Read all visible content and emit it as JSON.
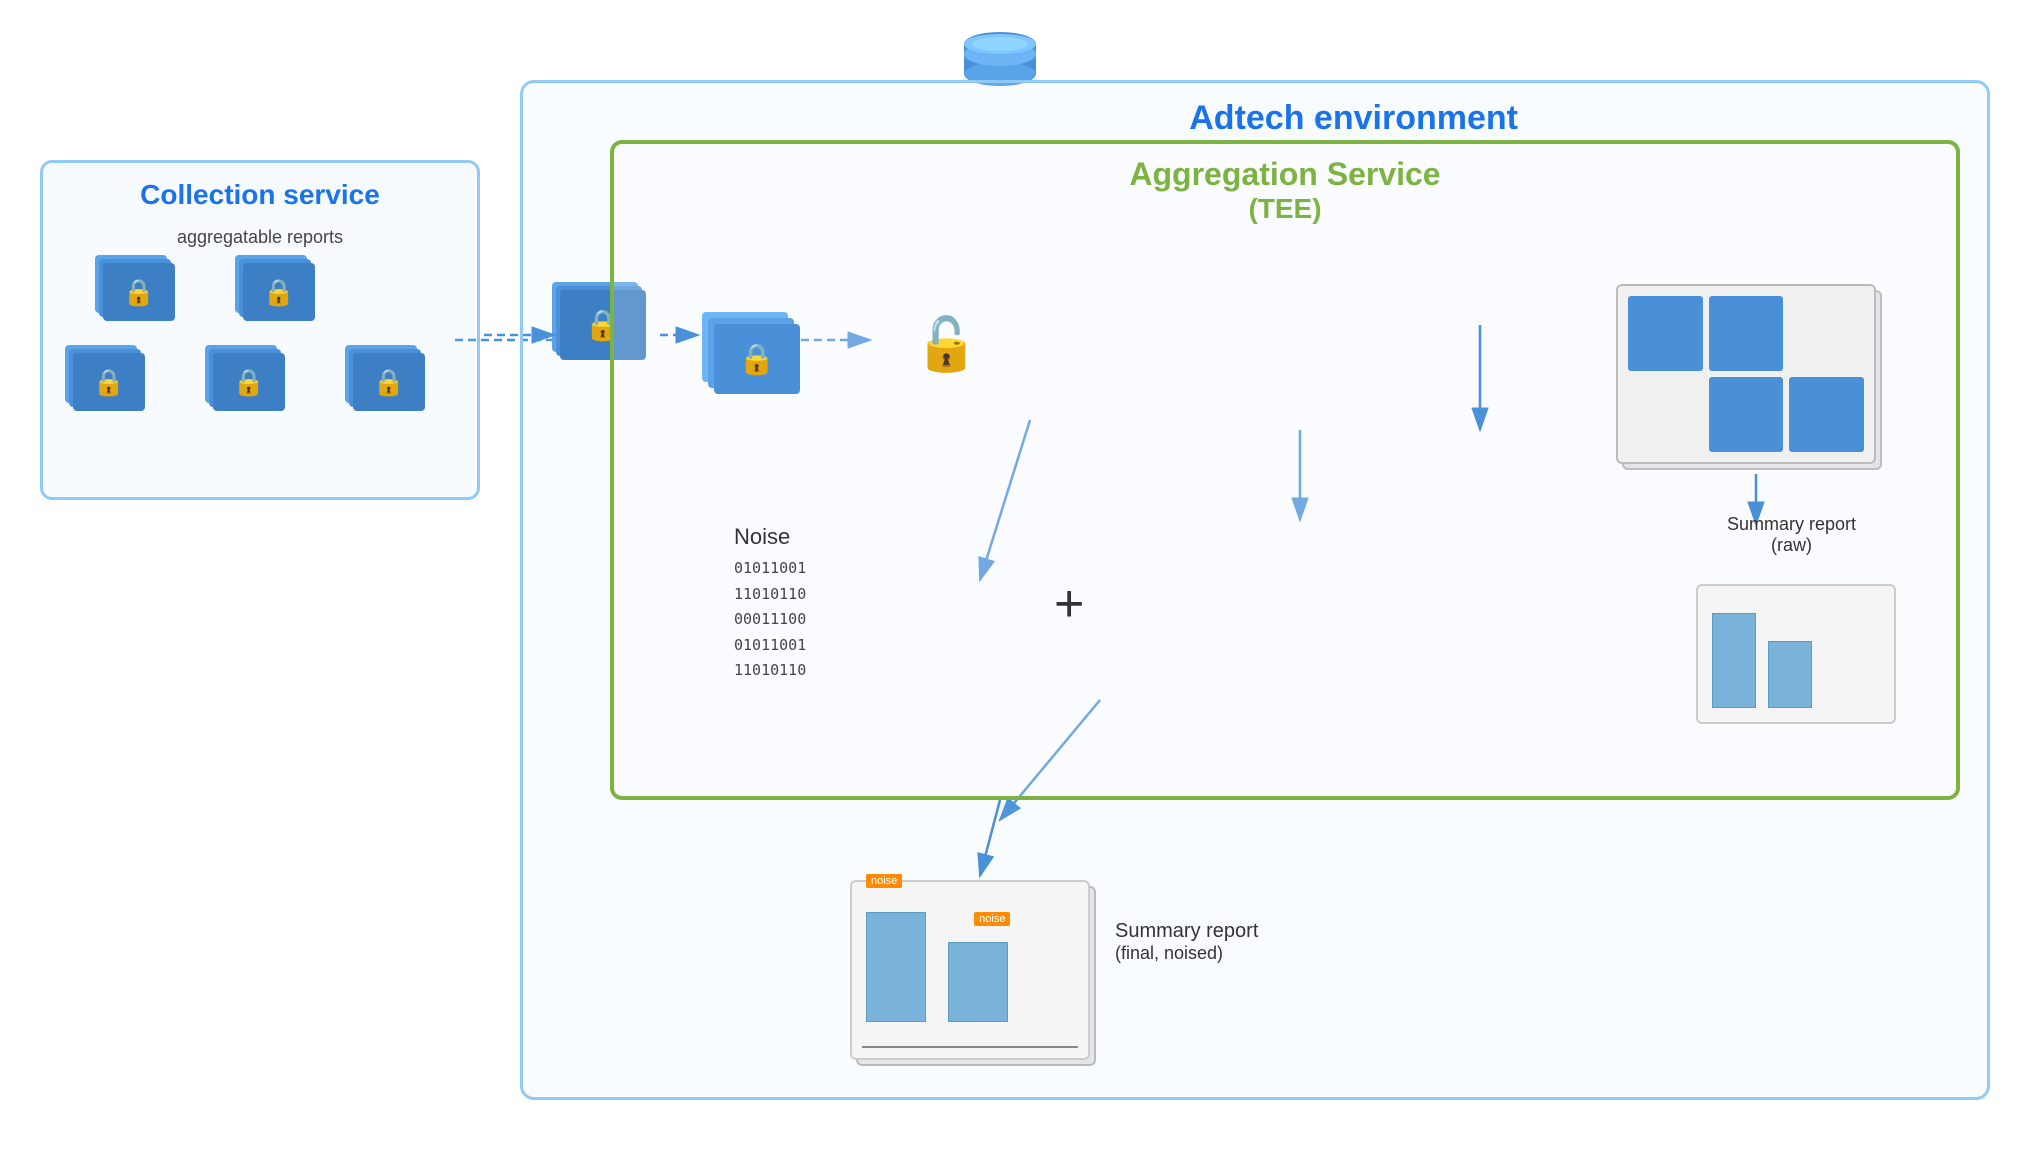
{
  "adtech": {
    "env_label": "Adtech environment",
    "aggregation_service_label": "Aggregation Service",
    "aggregation_service_sub": "(TEE)",
    "collection_service_label": "Collection service",
    "aggregatable_reports": "aggregatable reports",
    "noise_label": "Noise",
    "noise_binary": [
      "01011001",
      "11010110",
      "00011100",
      "01011001",
      "11010110"
    ],
    "summary_report_raw_label": "Summary report",
    "summary_report_raw_sub": "(raw)",
    "summary_report_final_label": "Summary report",
    "summary_report_final_sub": "(final, noised)",
    "noise_tag": "noise"
  }
}
